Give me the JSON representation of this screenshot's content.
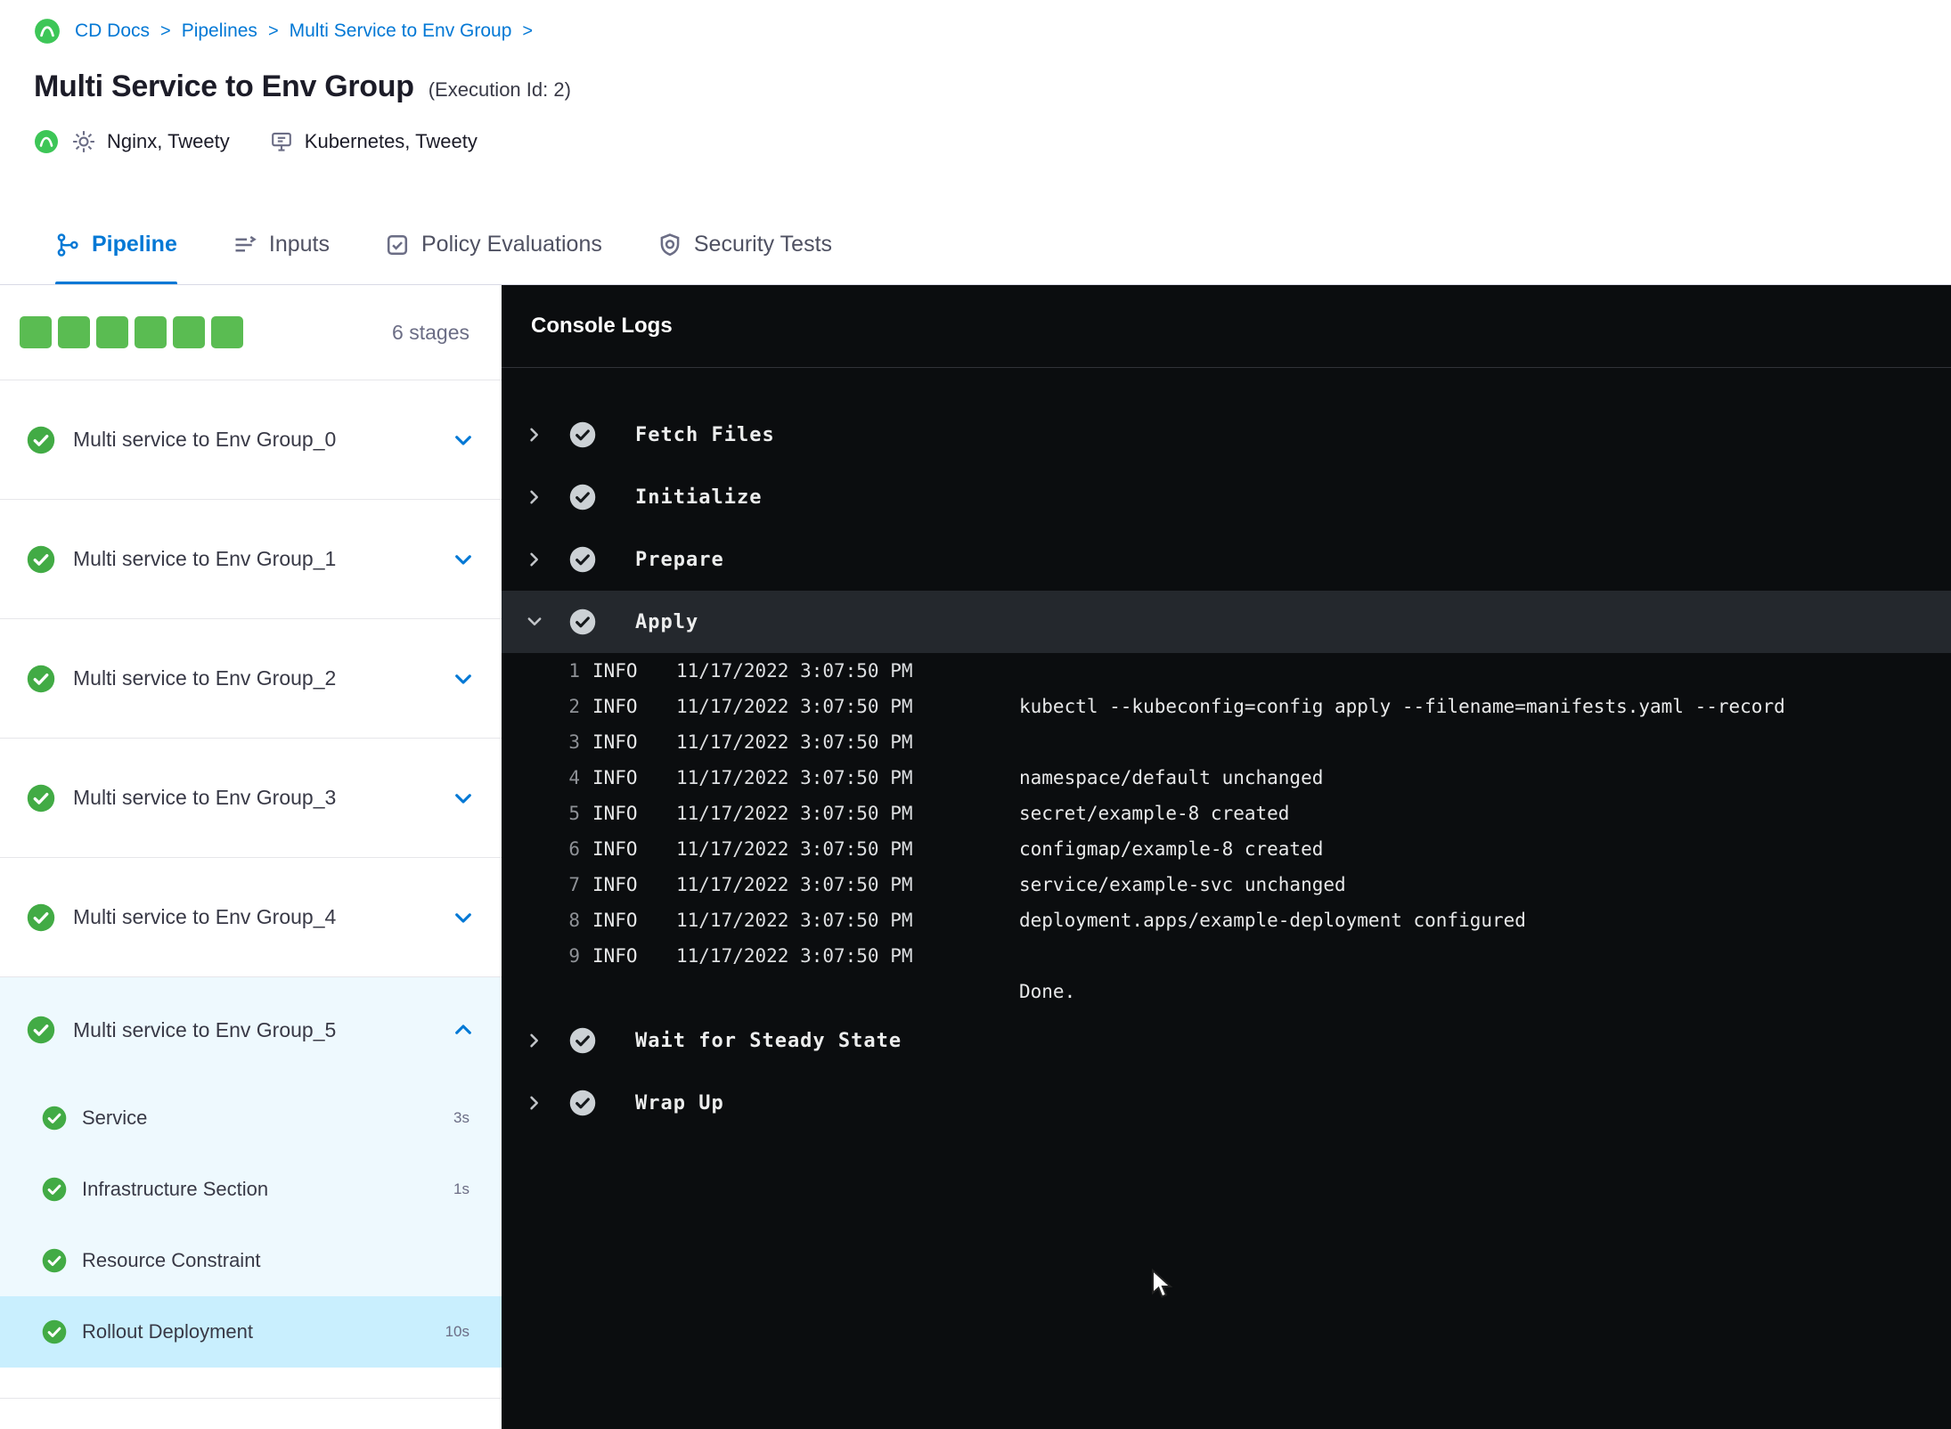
{
  "breadcrumb": {
    "items": [
      "CD Docs",
      "Pipelines",
      "Multi Service to Env Group"
    ],
    "separator": ">"
  },
  "header": {
    "title": "Multi Service to Env Group",
    "execution_id": "(Execution Id: 2)",
    "services": "Nginx, Tweety",
    "environments": "Kubernetes, Tweety"
  },
  "tabs": [
    {
      "label": "Pipeline",
      "active": true
    },
    {
      "label": "Inputs",
      "active": false
    },
    {
      "label": "Policy Evaluations",
      "active": false
    },
    {
      "label": "Security Tests",
      "active": false
    }
  ],
  "stages_panel": {
    "count_label": "6 stages",
    "squares": 6,
    "stages": [
      {
        "label": "Multi service to Env Group_0",
        "status": "success",
        "expanded": false
      },
      {
        "label": "Multi service to Env Group_1",
        "status": "success",
        "expanded": false
      },
      {
        "label": "Multi service to Env Group_2",
        "status": "success",
        "expanded": false
      },
      {
        "label": "Multi service to Env Group_3",
        "status": "success",
        "expanded": false
      },
      {
        "label": "Multi service to Env Group_4",
        "status": "success",
        "expanded": false
      },
      {
        "label": "Multi service to Env Group_5",
        "status": "success",
        "expanded": true,
        "steps": [
          {
            "label": "Service",
            "duration": "3s",
            "status": "success",
            "selected": false
          },
          {
            "label": "Infrastructure Section",
            "duration": "1s",
            "status": "success",
            "selected": false
          },
          {
            "label": "Resource Constraint",
            "duration": "",
            "status": "success",
            "selected": false
          },
          {
            "label": "Rollout Deployment",
            "duration": "10s",
            "status": "success",
            "selected": true
          }
        ]
      }
    ]
  },
  "console": {
    "title": "Console Logs",
    "sections": [
      {
        "label": "Fetch Files",
        "status": "success",
        "expanded": false
      },
      {
        "label": "Initialize",
        "status": "success",
        "expanded": false
      },
      {
        "label": "Prepare",
        "status": "success",
        "expanded": false
      },
      {
        "label": "Apply",
        "status": "success",
        "expanded": true,
        "lines": [
          {
            "n": "1",
            "level": "INFO",
            "time": "11/17/2022 3:07:50 PM",
            "msg": ""
          },
          {
            "n": "2",
            "level": "INFO",
            "time": "11/17/2022 3:07:50 PM",
            "msg": "kubectl --kubeconfig=config apply --filename=manifests.yaml --record"
          },
          {
            "n": "3",
            "level": "INFO",
            "time": "11/17/2022 3:07:50 PM",
            "msg": ""
          },
          {
            "n": "4",
            "level": "INFO",
            "time": "11/17/2022 3:07:50 PM",
            "msg": "namespace/default unchanged"
          },
          {
            "n": "5",
            "level": "INFO",
            "time": "11/17/2022 3:07:50 PM",
            "msg": "secret/example-8 created"
          },
          {
            "n": "6",
            "level": "INFO",
            "time": "11/17/2022 3:07:50 PM",
            "msg": "configmap/example-8 created"
          },
          {
            "n": "7",
            "level": "INFO",
            "time": "11/17/2022 3:07:50 PM",
            "msg": "service/example-svc unchanged"
          },
          {
            "n": "8",
            "level": "INFO",
            "time": "11/17/2022 3:07:50 PM",
            "msg": "deployment.apps/example-deployment configured"
          },
          {
            "n": "9",
            "level": "INFO",
            "time": "11/17/2022 3:07:50 PM",
            "msg": ""
          },
          {
            "n": "",
            "level": "",
            "time": "",
            "msg": "Done."
          }
        ]
      },
      {
        "label": "Wait for Steady State",
        "status": "success",
        "expanded": false
      },
      {
        "label": "Wrap Up",
        "status": "success",
        "expanded": false
      }
    ]
  },
  "colors": {
    "accent_blue": "#0278d5",
    "success_green": "#42ab45",
    "progress_square_green": "#5abc52",
    "console_background": "#0b0d0f",
    "selected_step_background": "#c9effe",
    "expanded_stage_background": "#eef9fe"
  }
}
